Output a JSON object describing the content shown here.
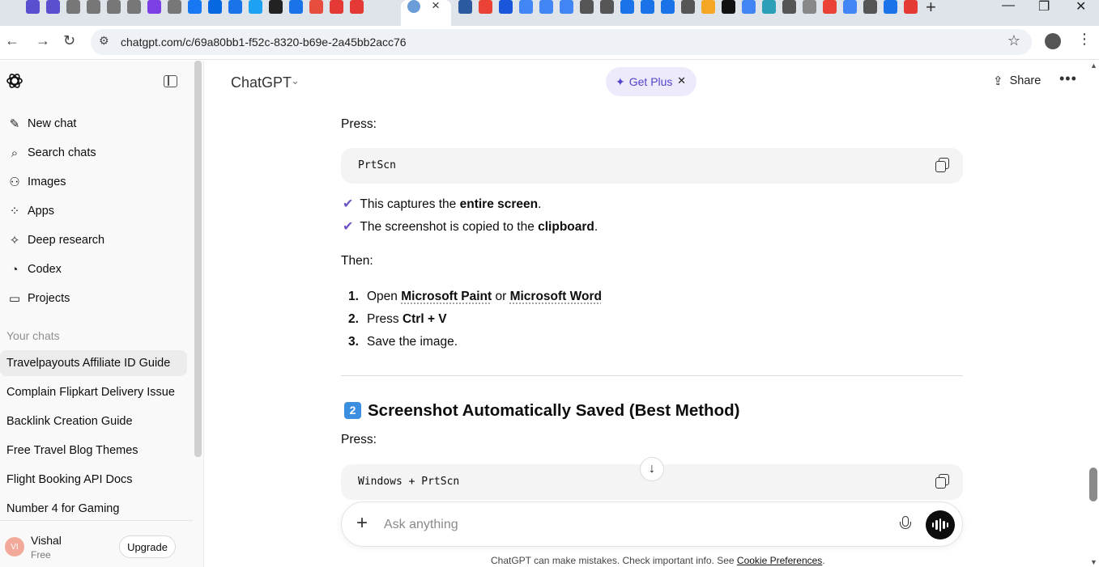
{
  "browser": {
    "url": "chatgpt.com/c/69a80bb1-f52c-8320-b69e-2a45bb2acc76",
    "tab_colors": [
      "#5a4fcf",
      "#5a4fcf",
      "#777",
      "#777",
      "#777",
      "#777",
      "#7b3fe4",
      "#777",
      "#1877f2",
      "#0668e1",
      "#1a73e8",
      "#1da1f2",
      "#222",
      "#1a73e8",
      "#e74c3c",
      "#e53935",
      "#e53935"
    ],
    "tab_colors_right": [
      "#2c5aa0",
      "#ea4335",
      "#1a56db",
      "#4285f4",
      "#4285f4",
      "#4285f4",
      "#555",
      "#555",
      "#1a73e8",
      "#1a73e8",
      "#1a73e8",
      "#555",
      "#f5a623",
      "#111",
      "#4285f4",
      "#2b9fb8",
      "#555",
      "#888",
      "#ea4335",
      "#4285f4",
      "#555",
      "#1a73e8",
      "#e53935"
    ]
  },
  "sidebar": {
    "items": [
      {
        "label": "New chat",
        "icon": "edit-icon",
        "glyph": "✎"
      },
      {
        "label": "Search chats",
        "icon": "search-icon",
        "glyph": "⌕"
      },
      {
        "label": "Images",
        "icon": "images-icon",
        "glyph": "⚇"
      },
      {
        "label": "Apps",
        "icon": "apps-icon",
        "glyph": "⁘"
      },
      {
        "label": "Deep research",
        "icon": "telescope-icon",
        "glyph": "✧"
      },
      {
        "label": "Codex",
        "icon": "codex-icon",
        "glyph": "◔"
      },
      {
        "label": "Projects",
        "icon": "folder-icon",
        "glyph": "▭"
      }
    ],
    "your_chats_heading": "Your chats",
    "chats": [
      "Travelpayouts Affiliate ID Guide",
      "Complain Flipkart Delivery Issue",
      "Backlink Creation Guide",
      "Free Travel Blog Themes",
      "Flight Booking API Docs",
      "Number 4 for Gaming"
    ],
    "user": {
      "initials": "VI",
      "name": "Vishal",
      "plan": "Free",
      "upgrade_label": "Upgrade"
    }
  },
  "header": {
    "model": "ChatGPT",
    "get_plus": "Get Plus",
    "share": "Share"
  },
  "content": {
    "press1": "Press:",
    "code1": "PrtScn",
    "check1_pre": "This captures the ",
    "check1_bold": "entire screen",
    "check1_post": ".",
    "check2_pre": "The screenshot is copied to the ",
    "check2_bold": "clipboard",
    "check2_post": ".",
    "then": "Then:",
    "steps": [
      {
        "n": "1.",
        "pre": "Open ",
        "b1": "Microsoft Paint",
        "mid": " or ",
        "b2": "Microsoft Word"
      },
      {
        "n": "2.",
        "pre": "Press ",
        "b1": "Ctrl + V"
      },
      {
        "n": "3.",
        "pre": "Save the image."
      }
    ],
    "section_num": "2",
    "section_title": "Screenshot Automatically Saved (Best Method)",
    "press2": "Press:",
    "code2": "Windows + PrtScn"
  },
  "composer": {
    "placeholder": "Ask anything",
    "disclaimer": "ChatGPT can make mistakes. Check important info. See ",
    "disclaimer_link": "Cookie Preferences",
    "disclaimer_end": "."
  }
}
